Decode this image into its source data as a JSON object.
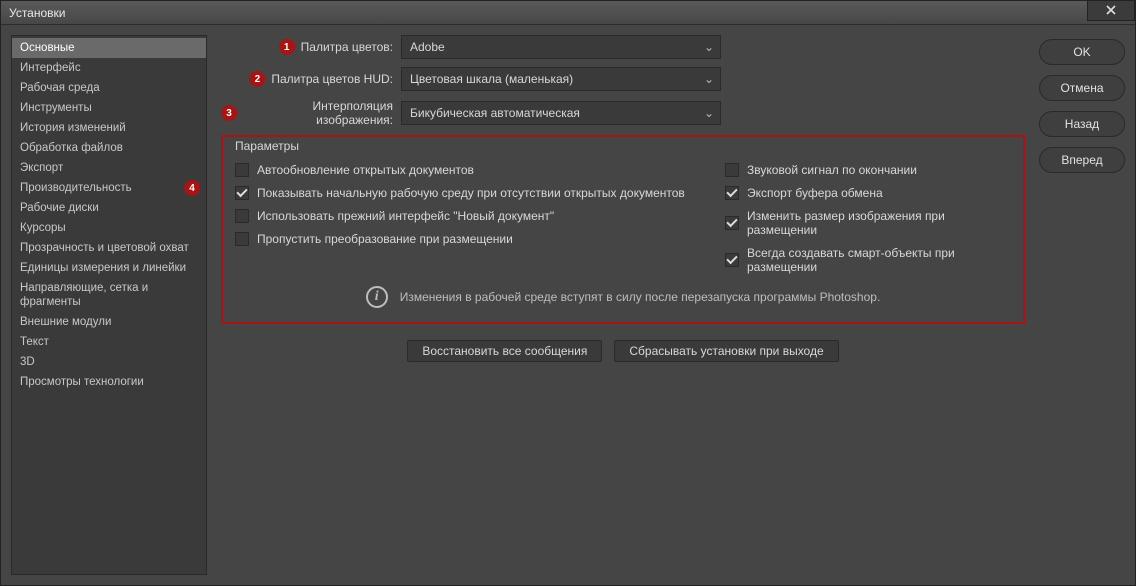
{
  "window": {
    "title": "Установки"
  },
  "sidebar": {
    "items": [
      "Основные",
      "Интерфейс",
      "Рабочая среда",
      "Инструменты",
      "История изменений",
      "Обработка файлов",
      "Экспорт",
      "Производительность",
      "Рабочие диски",
      "Курсоры",
      "Прозрачность и цветовой охват",
      "Единицы измерения и линейки",
      "Направляющие, сетка и фрагменты",
      "Внешние модули",
      "Текст",
      "3D",
      "Просмотры технологии"
    ],
    "selected_index": 0
  },
  "dropdowns": {
    "color_picker": {
      "label": "Палитра цветов:",
      "value": "Adobe"
    },
    "hud_picker": {
      "label": "Палитра цветов HUD:",
      "value": "Цветовая шкала (маленькая)"
    },
    "interpolation": {
      "label": "Интерполяция изображения:",
      "value": "Бикубическая автоматическая"
    }
  },
  "options": {
    "legend": "Параметры",
    "left": [
      {
        "label": "Автообновление открытых документов",
        "checked": false
      },
      {
        "label": "Показывать начальную рабочую среду при отсутствии открытых документов",
        "checked": true
      },
      {
        "label": "Использовать прежний интерфейс \"Новый документ\"",
        "checked": false
      },
      {
        "label": "Пропустить преобразование при размещении",
        "checked": false
      }
    ],
    "right": [
      {
        "label": "Звуковой сигнал по окончании",
        "checked": false
      },
      {
        "label": "Экспорт буфера обмена",
        "checked": true
      },
      {
        "label": "Изменить размер изображения при размещении",
        "checked": true
      },
      {
        "label": "Всегда создавать смарт-объекты при размещении",
        "checked": true
      }
    ],
    "info": "Изменения в рабочей среде вступят в силу после перезапуска программы Photoshop."
  },
  "buttons": {
    "restore_msgs": "Восстановить все сообщения",
    "reset_on_exit": "Сбрасывать установки при выходе",
    "ok": "OK",
    "cancel": "Отмена",
    "back": "Назад",
    "forward": "Вперед"
  },
  "annotations": {
    "1": "1",
    "2": "2",
    "3": "3",
    "4": "4"
  }
}
